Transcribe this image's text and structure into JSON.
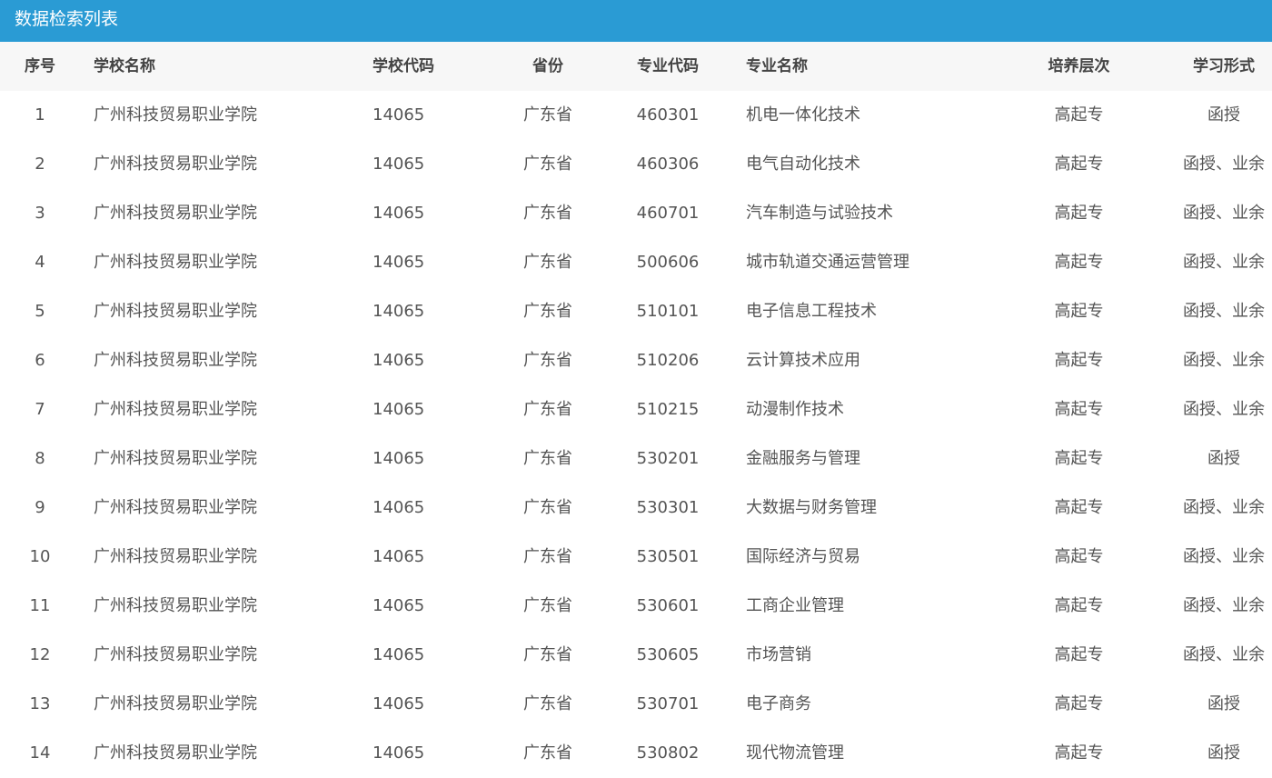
{
  "page": {
    "title": "数据检索列表"
  },
  "table": {
    "headers": {
      "no": "序号",
      "school_name": "学校名称",
      "school_code": "学校代码",
      "province": "省份",
      "major_code": "专业代码",
      "major_name": "专业名称",
      "level": "培养层次",
      "study_form": "学习形式"
    },
    "rows": [
      {
        "no": "1",
        "school_name": "广州科技贸易职业学院",
        "school_code": "14065",
        "province": "广东省",
        "major_code": "460301",
        "major_name": "机电一体化技术",
        "level": "高起专",
        "study_form": "函授"
      },
      {
        "no": "2",
        "school_name": "广州科技贸易职业学院",
        "school_code": "14065",
        "province": "广东省",
        "major_code": "460306",
        "major_name": "电气自动化技术",
        "level": "高起专",
        "study_form": "函授、业余"
      },
      {
        "no": "3",
        "school_name": "广州科技贸易职业学院",
        "school_code": "14065",
        "province": "广东省",
        "major_code": "460701",
        "major_name": "汽车制造与试验技术",
        "level": "高起专",
        "study_form": "函授、业余"
      },
      {
        "no": "4",
        "school_name": "广州科技贸易职业学院",
        "school_code": "14065",
        "province": "广东省",
        "major_code": "500606",
        "major_name": "城市轨道交通运营管理",
        "level": "高起专",
        "study_form": "函授、业余"
      },
      {
        "no": "5",
        "school_name": "广州科技贸易职业学院",
        "school_code": "14065",
        "province": "广东省",
        "major_code": "510101",
        "major_name": "电子信息工程技术",
        "level": "高起专",
        "study_form": "函授、业余"
      },
      {
        "no": "6",
        "school_name": "广州科技贸易职业学院",
        "school_code": "14065",
        "province": "广东省",
        "major_code": "510206",
        "major_name": "云计算技术应用",
        "level": "高起专",
        "study_form": "函授、业余"
      },
      {
        "no": "7",
        "school_name": "广州科技贸易职业学院",
        "school_code": "14065",
        "province": "广东省",
        "major_code": "510215",
        "major_name": "动漫制作技术",
        "level": "高起专",
        "study_form": "函授、业余"
      },
      {
        "no": "8",
        "school_name": "广州科技贸易职业学院",
        "school_code": "14065",
        "province": "广东省",
        "major_code": "530201",
        "major_name": "金融服务与管理",
        "level": "高起专",
        "study_form": "函授"
      },
      {
        "no": "9",
        "school_name": "广州科技贸易职业学院",
        "school_code": "14065",
        "province": "广东省",
        "major_code": "530301",
        "major_name": "大数据与财务管理",
        "level": "高起专",
        "study_form": "函授、业余"
      },
      {
        "no": "10",
        "school_name": "广州科技贸易职业学院",
        "school_code": "14065",
        "province": "广东省",
        "major_code": "530501",
        "major_name": "国际经济与贸易",
        "level": "高起专",
        "study_form": "函授、业余"
      },
      {
        "no": "11",
        "school_name": "广州科技贸易职业学院",
        "school_code": "14065",
        "province": "广东省",
        "major_code": "530601",
        "major_name": "工商企业管理",
        "level": "高起专",
        "study_form": "函授、业余"
      },
      {
        "no": "12",
        "school_name": "广州科技贸易职业学院",
        "school_code": "14065",
        "province": "广东省",
        "major_code": "530605",
        "major_name": "市场营销",
        "level": "高起专",
        "study_form": "函授、业余"
      },
      {
        "no": "13",
        "school_name": "广州科技贸易职业学院",
        "school_code": "14065",
        "province": "广东省",
        "major_code": "530701",
        "major_name": "电子商务",
        "level": "高起专",
        "study_form": "函授"
      },
      {
        "no": "14",
        "school_name": "广州科技贸易职业学院",
        "school_code": "14065",
        "province": "广东省",
        "major_code": "530802",
        "major_name": "现代物流管理",
        "level": "高起专",
        "study_form": "函授"
      }
    ]
  },
  "colors": {
    "title_bar_bg": "#2a9bd4",
    "header_row_bg": "#f7f7f7",
    "text": "#555555"
  }
}
